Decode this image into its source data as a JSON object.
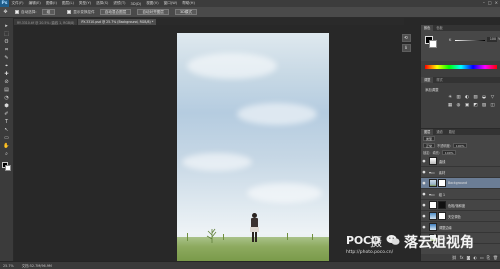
{
  "app": {
    "logo": "Ps"
  },
  "menubar": {
    "items": [
      "文件(F)",
      "编辑(E)",
      "图像(I)",
      "图层(L)",
      "类型(Y)",
      "选择(S)",
      "滤镜(T)",
      "3D(D)",
      "视图(V)",
      "窗口(W)",
      "帮助(H)"
    ],
    "controls": [
      "–",
      "□",
      "×"
    ]
  },
  "options": {
    "auto_select_label": "自动选择:",
    "group_value": "组",
    "transform_label": "显示变换控件",
    "buttons": [
      "自动混合图层",
      "自动对齐图层",
      "3D模式"
    ]
  },
  "tabs": [
    {
      "label": "RY-3310.tif @ 20.5% (曲线 1, RGB/8)",
      "active": false
    },
    {
      "label": "RY-3310.psd @ 25.7% (Background, RGB/8) *",
      "active": true
    }
  ],
  "tools": [
    "▸",
    "⬚",
    "ʘ",
    "⌗",
    "✎",
    "⌖",
    "✚",
    "⊘",
    "▤",
    "◔",
    "⬢",
    "✐",
    "T",
    "↖",
    "▭",
    "✋",
    "⌕"
  ],
  "right_panels": {
    "color_tabs": [
      "颜色",
      "色板"
    ],
    "k_label": "K",
    "k_value": "100",
    "k_unit": "%",
    "adjust_tabs": [
      "调整",
      "样式"
    ],
    "adjust_title": "添加调整",
    "adjust_icons": [
      "☀",
      "▥",
      "◐",
      "▧",
      "◒",
      "▽",
      "▦",
      "◍",
      "▣",
      "◩",
      "▨",
      "◫"
    ]
  },
  "layers": {
    "tabs": [
      "图层",
      "通道",
      "路径"
    ],
    "kind_label": "类型",
    "blend_mode": "正常",
    "opacity_label": "不透明度:",
    "opacity_value": "100%",
    "lock_label": "锁定:",
    "fill_label": "填充:",
    "fill_value": "100%",
    "list": [
      {
        "name": "曲线",
        "type": "adjust",
        "selected": false
      },
      {
        "name": "素材",
        "type": "group",
        "selected": false
      },
      {
        "name": "Background",
        "type": "photo",
        "selected": true
      },
      {
        "name": "组 1",
        "type": "group",
        "selected": false
      },
      {
        "name": "色相/饱和度",
        "type": "adjust-mask",
        "selected": false
      },
      {
        "name": "天空调色",
        "type": "sky",
        "selected": false
      },
      {
        "name": "调整边缘",
        "type": "sky",
        "selected": false
      },
      {
        "name": "草地",
        "type": "grass",
        "selected": false
      }
    ],
    "bottom_icons": [
      "⛓",
      "fx",
      "◙",
      "◐",
      "▭",
      "⎘",
      "🗑"
    ]
  },
  "status": {
    "zoom": "25.7%",
    "doc": "文档:52.7M/96.9M"
  },
  "watermark": {
    "logo": "POCO",
    "cn_partial": "摄",
    "url": "http://photo.poco.cn/",
    "brand": "落云姐视角"
  }
}
